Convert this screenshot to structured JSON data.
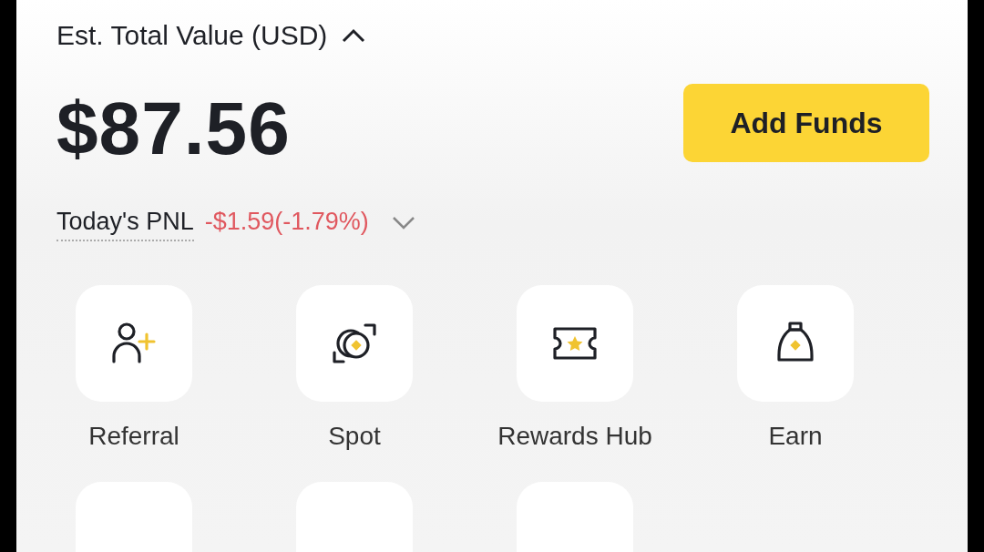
{
  "header": {
    "label": "Est. Total Value (USD)",
    "expanded": true
  },
  "balance": "$87.56",
  "add_funds": "Add Funds",
  "pnl": {
    "label": "Today's PNL",
    "value": "-$1.59(-1.79%)"
  },
  "shortcuts": [
    {
      "kind": "referral",
      "label": "Referral"
    },
    {
      "kind": "spot",
      "label": "Spot"
    },
    {
      "kind": "rewards",
      "label": "Rewards Hub"
    },
    {
      "kind": "earn",
      "label": "Earn"
    }
  ]
}
